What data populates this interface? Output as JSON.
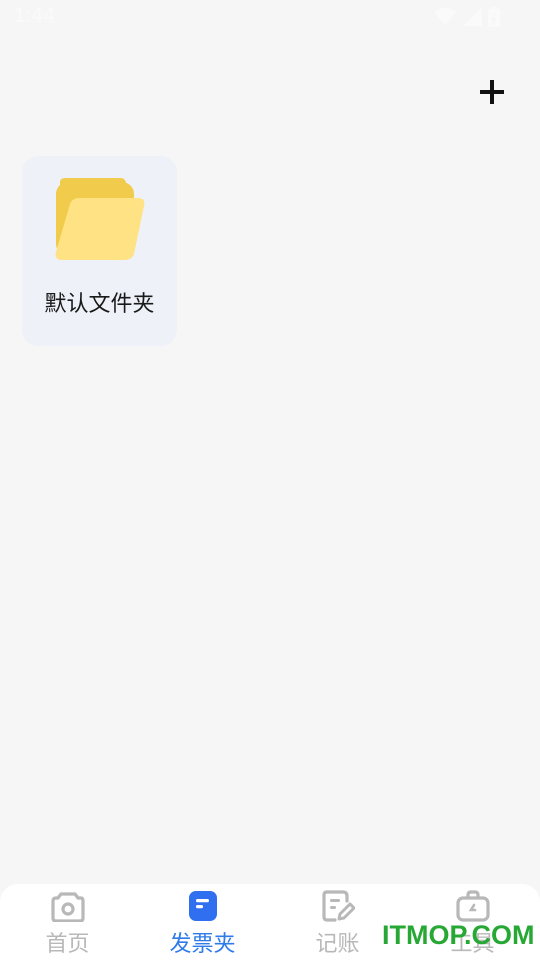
{
  "status_bar": {
    "time": "1:44"
  },
  "header": {
    "add_icon": "plus-icon"
  },
  "folders": [
    {
      "name": "默认文件夹",
      "icon": "folder-icon",
      "icon_color": "#f5d462"
    }
  ],
  "bottom_nav": {
    "items": [
      {
        "label": "首页",
        "icon": "camera-icon",
        "active": false
      },
      {
        "label": "发票夹",
        "icon": "invoice-folder-icon",
        "active": true
      },
      {
        "label": "记账",
        "icon": "edit-note-icon",
        "active": false
      },
      {
        "label": "工具",
        "icon": "toolbox-icon",
        "active": false
      }
    ],
    "active_color": "#2f7be8",
    "inactive_color": "#b8b8b8"
  },
  "watermark": {
    "text": "ITMOP.COM",
    "color": "#27a834"
  }
}
